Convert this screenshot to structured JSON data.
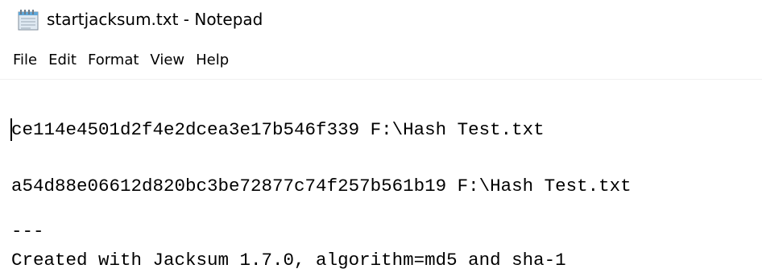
{
  "window": {
    "title": "startjacksum.txt - Notepad",
    "app_icon": "notepad-icon"
  },
  "menu": {
    "items": [
      "File",
      "Edit",
      "Format",
      "View",
      "Help"
    ]
  },
  "editor": {
    "lines": [
      "ce114e4501d2f4e2dcea3e17b546f339 F:\\Hash Test.txt",
      "a54d88e06612d820bc3be72877c74f257b561b19 F:\\Hash Test.txt",
      "---",
      "Created with Jacksum 1.7.0, algorithm=md5 and sha-1"
    ]
  }
}
